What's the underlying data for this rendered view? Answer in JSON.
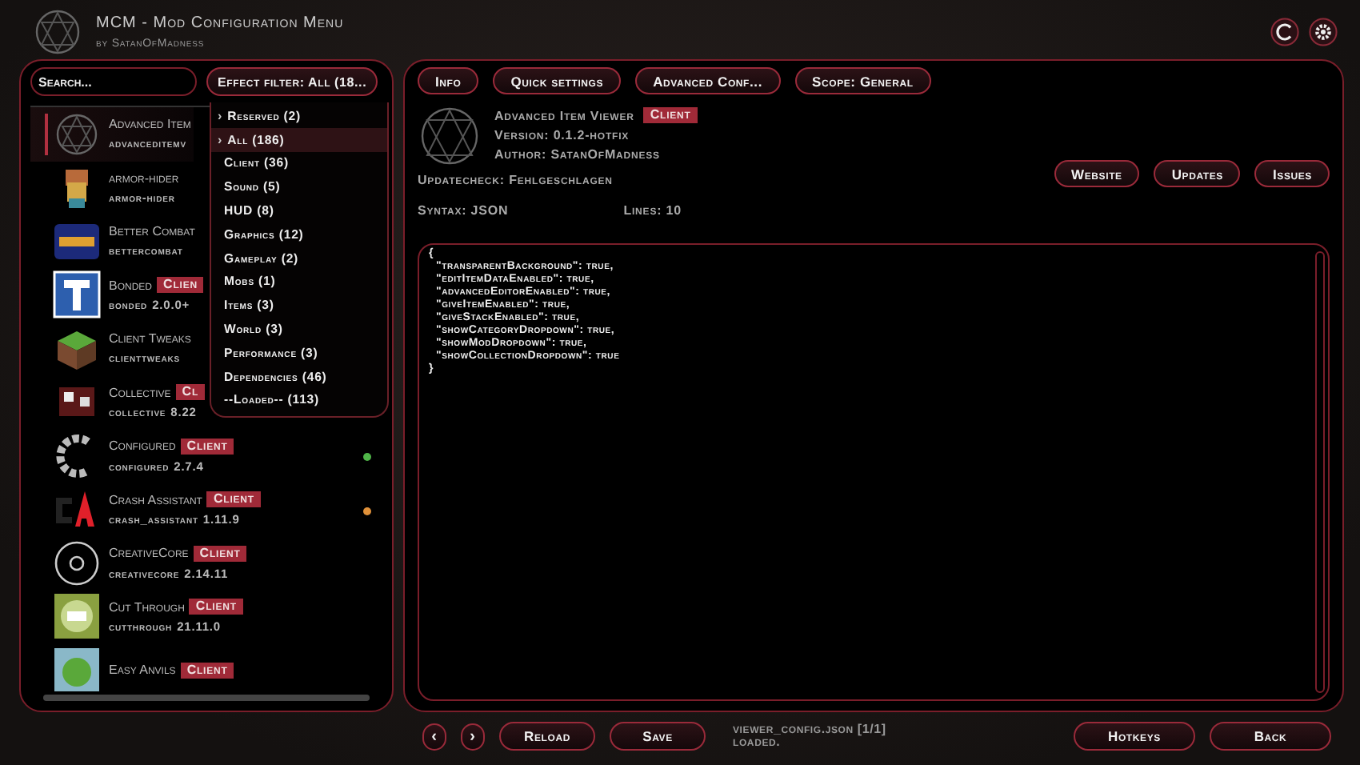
{
  "header": {
    "title": "MCM - Mod Configuration Menu",
    "subtitle": "by SatanOfMadness"
  },
  "sidebar": {
    "search": {
      "placeholder": "Search..."
    },
    "filter": {
      "label": "Effect filter: All (18..."
    },
    "filter_menu": [
      {
        "marker": "›",
        "label": "Reserved (2)",
        "selected": false
      },
      {
        "marker": "›",
        "label": "All (186)",
        "selected": true
      },
      {
        "label": "Client (36)",
        "selected": false
      },
      {
        "label": "Sound (5)",
        "selected": false
      },
      {
        "label": "HUD (8)",
        "selected": false
      },
      {
        "label": "Graphics (12)",
        "selected": false
      },
      {
        "label": "Gameplay (2)",
        "selected": false
      },
      {
        "label": "Mobs (1)",
        "selected": false
      },
      {
        "label": "Items (3)",
        "selected": false
      },
      {
        "label": "World (3)",
        "selected": false
      },
      {
        "label": "Performance (3)",
        "selected": false
      },
      {
        "label": "Dependencies (46)",
        "selected": false
      },
      {
        "label": "--Loaded-- (113)",
        "selected": false
      }
    ],
    "mods": [
      {
        "name": "Advanced Item",
        "id": "advanceditemv",
        "selected": true
      },
      {
        "name": "armor-hider",
        "id": "armor-hider",
        "selected": false
      },
      {
        "name": "Better Combat",
        "id": "bettercombat",
        "selected": false
      },
      {
        "name": "Bonded",
        "badge": "Clien",
        "id": "bonded",
        "version": "2.0.0+",
        "selected": false
      },
      {
        "name": "Client Tweaks",
        "id": "clienttweaks",
        "selected": false
      },
      {
        "name": "Collective",
        "badge": "Cl",
        "id": "collective",
        "version": "8.22",
        "selected": false
      },
      {
        "name": "Configured",
        "badge": "Client",
        "id": "configured",
        "version": "2.7.4",
        "color": "#4fb548",
        "selected": false
      },
      {
        "name": "Crash Assistant",
        "badge": "Client",
        "id": "crash_assistant",
        "version": "1.11.9",
        "color": "#e0913a",
        "selected": false
      },
      {
        "name": "CreativeCore",
        "badge": "Client",
        "id": "creativecore",
        "version": "2.14.11",
        "selected": false
      },
      {
        "name": "Cut Through",
        "badge": "Client",
        "id": "cutthrough",
        "version": "21.11.0",
        "selected": false
      },
      {
        "name": "Easy Anvils",
        "badge": "Client",
        "selected": false
      }
    ]
  },
  "tabs": [
    "Info",
    "Quick settings",
    "Advanced Conf...",
    "Scope: General"
  ],
  "detail": {
    "name": "Advanced Item Viewer",
    "badge": "Client",
    "version": "Version: 0.1.2-hotfix",
    "author": "Author: SatanOfMadness",
    "updatecheck": "Updatecheck: Fehlgeschlagen",
    "links": [
      "Website",
      "Updates",
      "Issues"
    ],
    "syntax": "Syntax: JSON",
    "lines": "Lines: 10"
  },
  "editor": {
    "lines": [
      "{",
      "  \"transparentBackground\": true,",
      "  \"editItemDataEnabled\": true,",
      "  \"advancedEditorEnabled\": true,",
      "  \"giveItemEnabled\": true,",
      "  \"giveStackEnabled\": true,",
      "  \"showCategoryDropdown\": true,",
      "  \"showModDropdown\": true,",
      "  \"showCollectionDropdown\": true",
      "}"
    ]
  },
  "footer": {
    "prev": "‹",
    "next": "›",
    "buttons": [
      "Reload",
      "Save"
    ],
    "file": "viewer_config.json [1/1]",
    "status": "loaded.",
    "right_buttons": [
      "Hotkeys",
      "Back"
    ]
  }
}
